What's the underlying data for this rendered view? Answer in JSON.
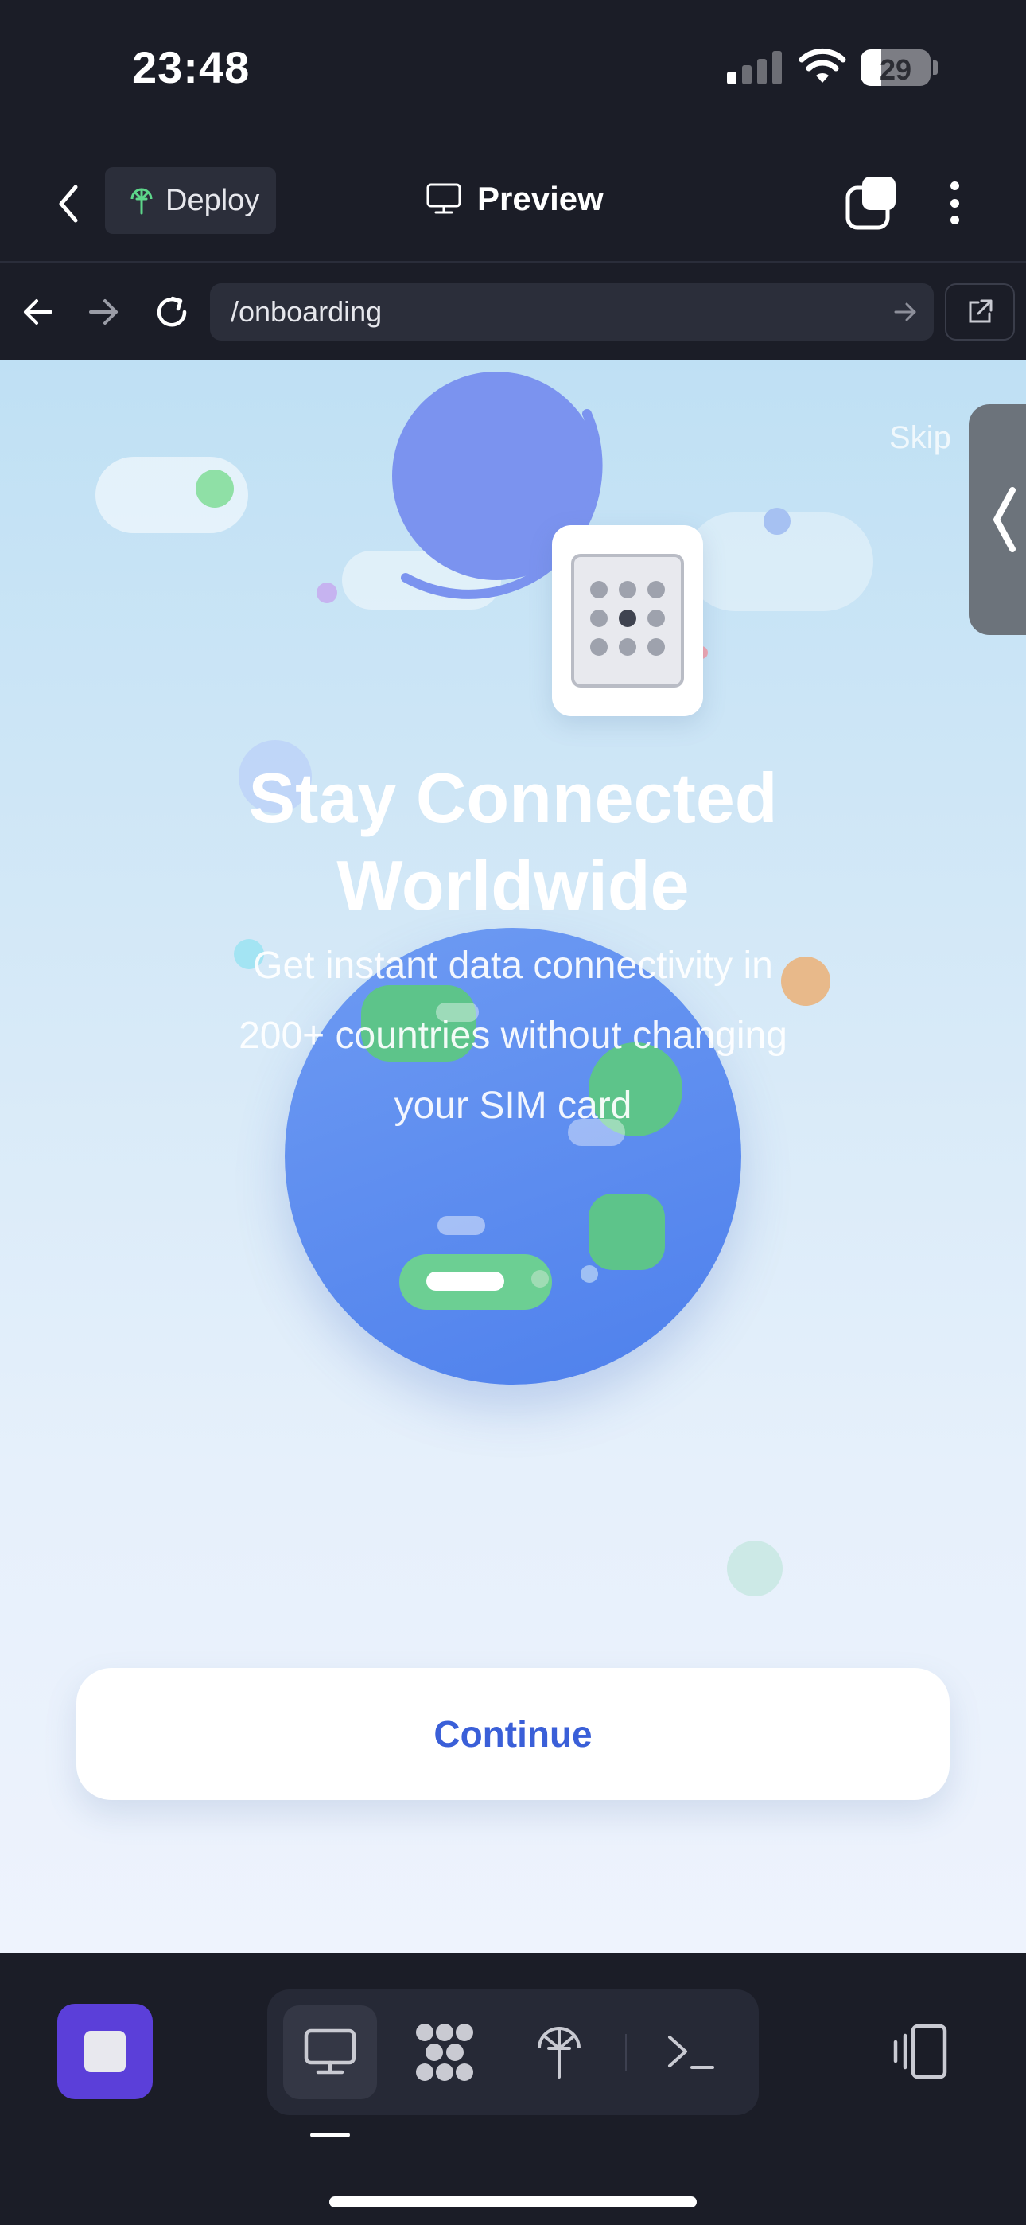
{
  "status_bar": {
    "time": "23:48",
    "battery": "29",
    "battery_level": 0.29,
    "icons": [
      "signal-icon",
      "wifi-icon",
      "battery-icon"
    ]
  },
  "header": {
    "back_icon": "chevron-left-icon",
    "deploy_label": "Deploy",
    "deploy_icon": "deploy-tree-icon",
    "preview_label": "Preview",
    "preview_icon": "monitor-icon",
    "tabs_icon": "tabs-icon",
    "more_icon": "more-vertical-icon"
  },
  "browser": {
    "back_icon": "arrow-left-icon",
    "forward_icon": "arrow-right-icon",
    "reload_icon": "reload-icon",
    "url": "/onboarding",
    "go_icon": "arrow-right-icon",
    "external_icon": "external-link-icon"
  },
  "onboarding": {
    "skip_label": "Skip",
    "title_line1": "Stay Connected",
    "title_line2": "Worldwide",
    "subtitle_line1": "Get instant data connectivity in",
    "subtitle_line2": "200+ countries without changing",
    "subtitle_line3": "your SIM card",
    "continue_label": "Continue",
    "side_tab_icon": "chevron-left-icon",
    "colors": {
      "accent": "#3a5fd8",
      "globe": "#5b8cf0",
      "land": "#5dc48a",
      "planet": "#7b93ef"
    }
  },
  "toolbar": {
    "stop_icon": "stop-icon",
    "tools": [
      "monitor-icon",
      "grid-dots-icon",
      "deploy-tree-icon",
      "terminal-icon"
    ],
    "active_tool": "monitor-icon",
    "device_icon": "device-toggle-icon"
  }
}
